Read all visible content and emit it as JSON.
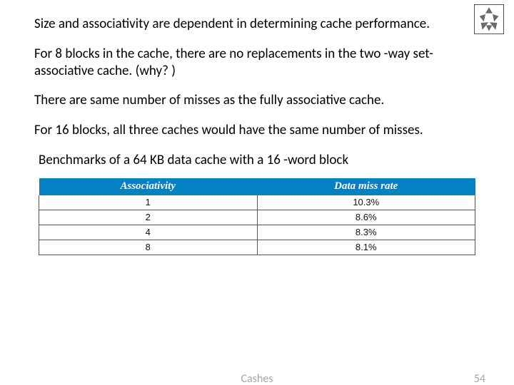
{
  "paragraphs": {
    "p1": "Size and associativity are dependent in determining cache performance.",
    "p2": "For 8 blocks in the cache, there are no replacements in the two -way set-associative cache. (why? )",
    "p3": "There are same number of misses as the fully associative cache.",
    "p4": "For 16 blocks, all three caches would have the same number of misses.",
    "bench": "Benchmarks of a 64 KB data cache with a 16 -word block"
  },
  "chart_data": {
    "type": "table",
    "columns": [
      "Associativity",
      "Data miss rate"
    ],
    "rows": [
      {
        "assoc": "1",
        "rate": "10.3%"
      },
      {
        "assoc": "2",
        "rate": "8.6%"
      },
      {
        "assoc": "4",
        "rate": "8.3%"
      },
      {
        "assoc": "8",
        "rate": "8.1%"
      }
    ]
  },
  "footer": {
    "title": "Cashes",
    "page": "54"
  }
}
